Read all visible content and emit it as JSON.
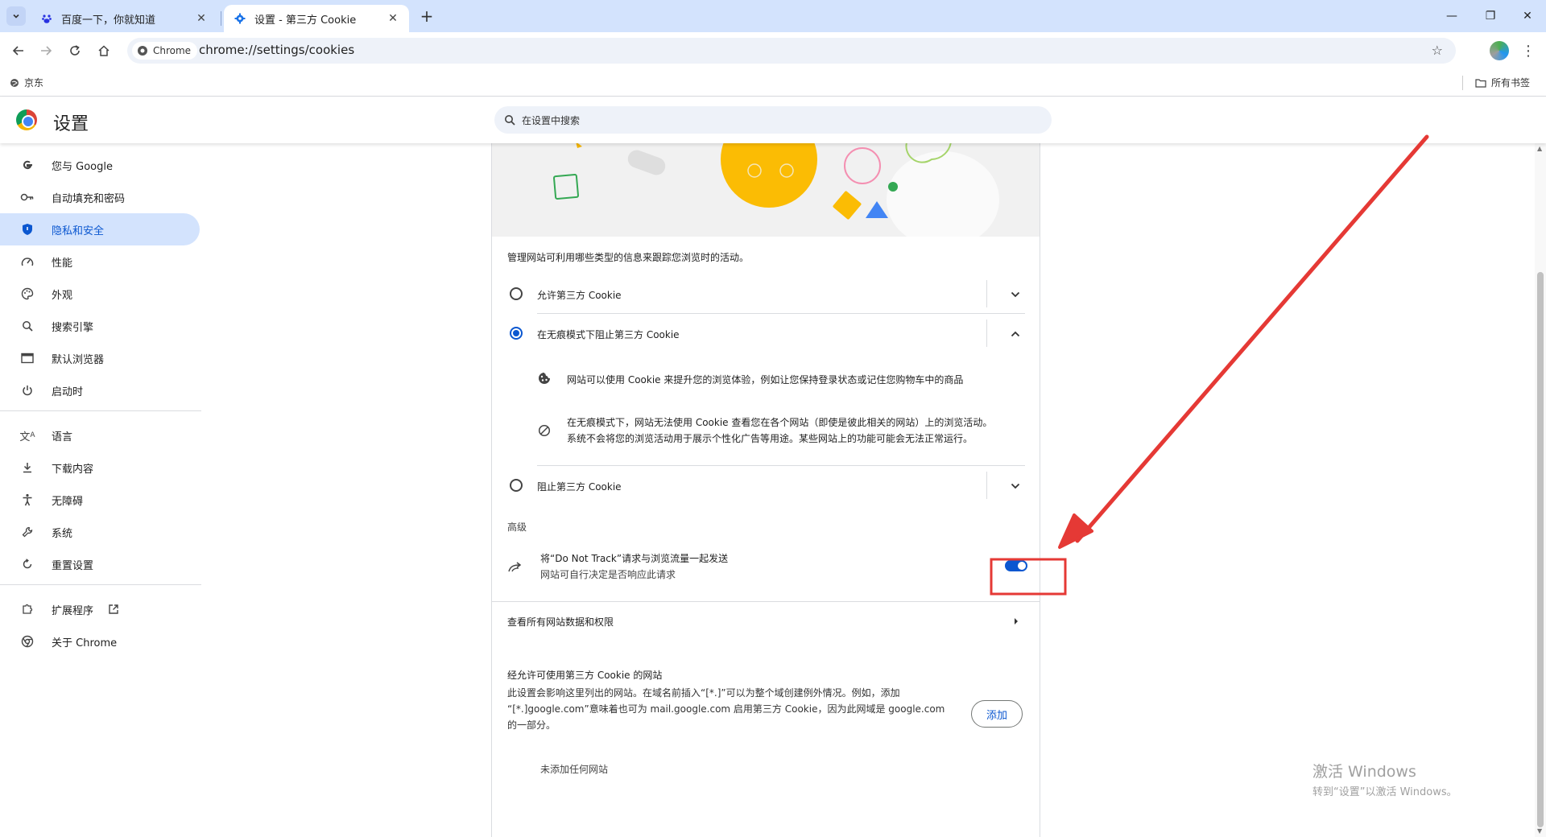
{
  "browser": {
    "tabs": [
      {
        "title": "百度一下，你就知道",
        "icon": "baidu-icon",
        "active": false
      },
      {
        "title": "设置 - 第三方 Cookie",
        "icon": "gear-icon",
        "active": true
      }
    ],
    "new_tab_label": "+",
    "omnibox": {
      "chip_label": "Chrome",
      "url": "chrome://settings/cookies"
    },
    "bookmarks": {
      "item": "京东",
      "all_bookmarks": "所有书签"
    }
  },
  "settings": {
    "title": "设置",
    "search_placeholder": "在设置中搜索",
    "sidebar": [
      {
        "label": "您与 Google",
        "icon": "google-icon"
      },
      {
        "label": "自动填充和密码",
        "icon": "key-icon"
      },
      {
        "label": "隐私和安全",
        "icon": "shield-icon",
        "selected": true
      },
      {
        "label": "性能",
        "icon": "speedometer-icon"
      },
      {
        "label": "外观",
        "icon": "palette-icon"
      },
      {
        "label": "搜索引擎",
        "icon": "search-icon"
      },
      {
        "label": "默认浏览器",
        "icon": "browser-window-icon"
      },
      {
        "label": "启动时",
        "icon": "power-icon"
      },
      {
        "label": "语言",
        "icon": "translate-icon"
      },
      {
        "label": "下载内容",
        "icon": "download-icon"
      },
      {
        "label": "无障碍",
        "icon": "accessibility-icon"
      },
      {
        "label": "系统",
        "icon": "wrench-icon"
      },
      {
        "label": "重置设置",
        "icon": "reset-icon"
      },
      {
        "label": "扩展程序",
        "icon": "puzzle-icon"
      },
      {
        "label": "关于 Chrome",
        "icon": "chrome-icon"
      }
    ],
    "cookies": {
      "intro": "管理网站可利用哪些类型的信息来跟踪您浏览时的活动。",
      "options": [
        {
          "label": "允许第三方 Cookie",
          "checked": false,
          "expanded": false
        },
        {
          "label": "在无痕模式下阻止第三方 Cookie",
          "checked": true,
          "expanded": true
        },
        {
          "label": "阻止第三方 Cookie",
          "checked": false,
          "expanded": false
        }
      ],
      "detail_1": "网站可以使用 Cookie 来提升您的浏览体验，例如让您保持登录状态或记住您购物车中的商品",
      "detail_2_line1": "在无痕模式下，网站无法使用 Cookie 查看您在各个网站（即使是彼此相关的网站）上的浏览活动。",
      "detail_2_line2": "系统不会将您的浏览活动用于展示个性化广告等用途。某些网站上的功能可能会无法正常运行。",
      "advanced_heading": "高级",
      "dnt_title": "将“Do Not Track”请求与浏览流量一起发送",
      "dnt_subtitle": "网站可自行决定是否响应此请求",
      "dnt_enabled": true,
      "view_all_label": "查看所有网站数据和权限",
      "allowed_heading": "经允许可使用第三方 Cookie 的网站",
      "allowed_desc_line1": "此设置会影响这里列出的网站。在域名前插入“[*.]”可以为整个域创建例外情况。例如，添加",
      "allowed_desc_line2": "“[*.]google.com”意味着也可为 mail.google.com 启用第三方 Cookie，因为此网域是 google.com",
      "allowed_desc_line3": "的一部分。",
      "add_button": "添加",
      "empty_list": "未添加任何网站"
    }
  },
  "watermark": {
    "line1": "激活 Windows",
    "line2": "转到“设置”以激活 Windows。"
  },
  "colors": {
    "accent": "#0b57d0",
    "tab_strip": "#d3e3fd",
    "annotation": "#e53935"
  }
}
